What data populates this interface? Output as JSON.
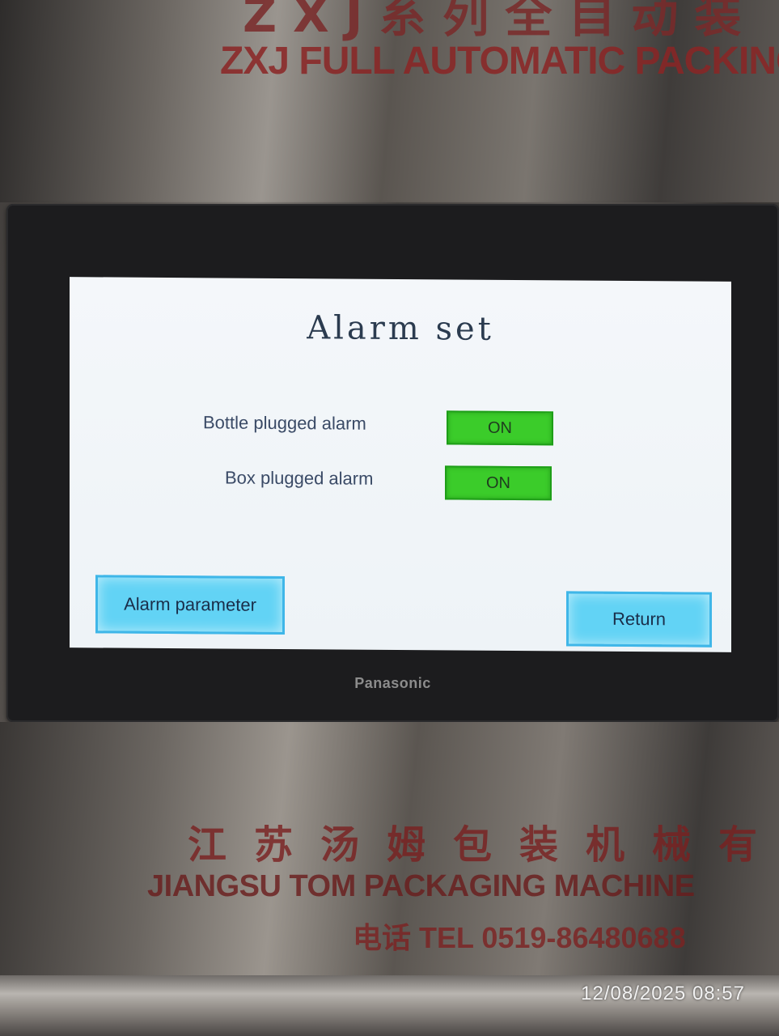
{
  "machine": {
    "top_chinese": "ZXJ系列全自动装",
    "top_label": "ZXJ FULL AUTOMATIC PACKING",
    "bottom_chinese": "江苏汤姆包装机械有",
    "bottom_label": "JIANGSU TOM PACKAGING MACHINE",
    "bottom_tel": "电话 TEL 0519-86480688"
  },
  "hmi": {
    "brand": "Panasonic",
    "title": "Alarm set",
    "alarms": [
      {
        "label": "Bottle plugged alarm",
        "state": "ON"
      },
      {
        "label": "Box plugged alarm",
        "state": "ON"
      }
    ],
    "buttons": {
      "alarm_parameter": "Alarm parameter",
      "return": "Return"
    },
    "colors": {
      "toggle_on": "#3bcc2a",
      "button": "#62d3f5",
      "screen_bg": "#f0f4f8"
    }
  },
  "photo": {
    "timestamp": "12/08/2025 08:57"
  }
}
